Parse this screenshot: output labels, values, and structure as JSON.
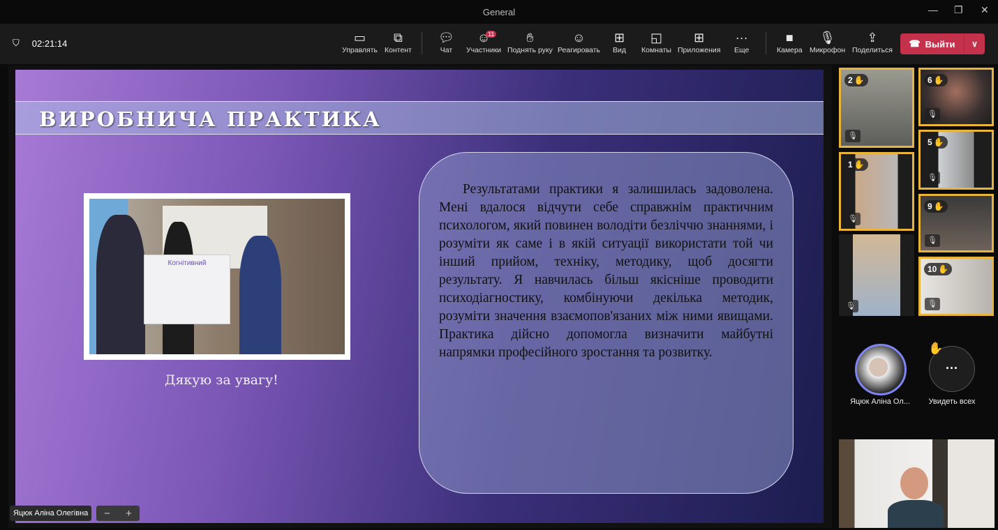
{
  "window": {
    "title": "General"
  },
  "meeting": {
    "timer": "02:21:14"
  },
  "toolbar": {
    "items": [
      {
        "label": "Управлять",
        "icon": "share-tray-icon"
      },
      {
        "label": "Контент",
        "icon": "content-icon"
      },
      {
        "label": "Чат",
        "icon": "chat-icon"
      },
      {
        "label": "Участники",
        "icon": "people-icon",
        "badge": "11"
      },
      {
        "label": "Поднять руку",
        "icon": "raise-hand-icon"
      },
      {
        "label": "Реагировать",
        "icon": "smile-icon"
      },
      {
        "label": "Вид",
        "icon": "grid-icon"
      },
      {
        "label": "Комнаты",
        "icon": "rooms-icon"
      },
      {
        "label": "Приложения",
        "icon": "plus-icon"
      },
      {
        "label": "Еще",
        "icon": "more-icon"
      },
      {
        "label": "Камера",
        "icon": "camera-icon"
      },
      {
        "label": "Микрофон",
        "icon": "mic-icon"
      },
      {
        "label": "Поделиться",
        "icon": "share-icon"
      }
    ],
    "leave_label": "Выйти"
  },
  "slide": {
    "title": "ВИРОБНИЧА ПРАКТИКА",
    "board_text": "Когнітивний",
    "caption": "Дякую за увагу!",
    "body": "Результатами практики я залишилась задоволена. Мені вдалося відчути себе справжнім практичним психологом, який повинен володіти безліччю знаннями, і розуміти як саме і в якій ситуації використати той чи інший прийом, техніку, методику, щоб досягти результату. Я навчилась більш якісніше проводити психодіагностику, комбінуючи декілька методик, розуміти значення взаємопов'язаних між ними явищами. Практика дійсно допомогла визначити майбутні напрямки професійного зростання та розвитку."
  },
  "presenter": {
    "name": "Яцюк Аліна Олегівна"
  },
  "participants": {
    "tiles": [
      {
        "hand_order": "2"
      },
      {
        "hand_order": "6"
      },
      {
        "hand_order": "5"
      },
      {
        "hand_order": "1"
      },
      {
        "hand_order": "9"
      },
      {
        "hand_order": "10"
      }
    ],
    "avatar_name": "Яцюк Аліна Ол...",
    "see_all": "Увидеть всех"
  }
}
